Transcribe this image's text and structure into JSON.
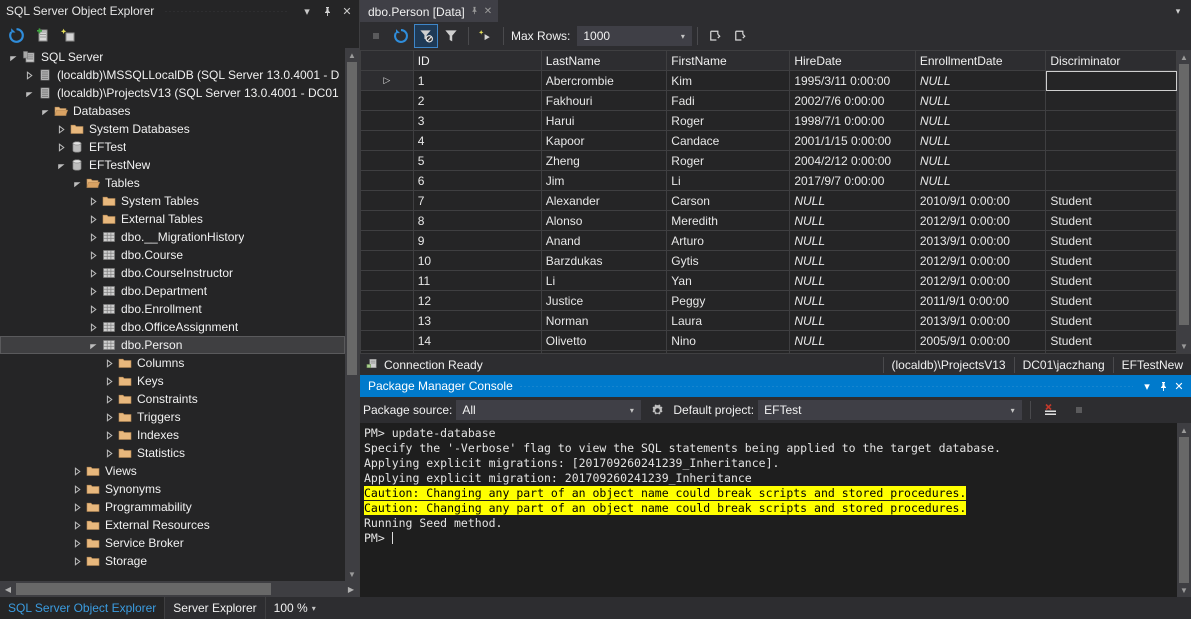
{
  "explorer": {
    "title": "SQL Server Object Explorer",
    "window_buttons": {
      "dropdown": "▾",
      "pin": "⚲",
      "close": "✕"
    },
    "toolbar": [
      {
        "name": "refresh-icon",
        "title": "Refresh"
      },
      {
        "name": "add-sql-server-icon",
        "title": "Add SQL Server"
      },
      {
        "name": "new-query-icon",
        "title": "New Query"
      }
    ],
    "tree": [
      {
        "label": "SQL Server",
        "depth": 0,
        "icon": "server-group-icon",
        "state": "expanded",
        "selected": false
      },
      {
        "label": "(localdb)\\MSSQLLocalDB (SQL Server 13.0.4001 - D",
        "depth": 1,
        "icon": "server-icon",
        "state": "collapsed",
        "selected": false
      },
      {
        "label": "(localdb)\\ProjectsV13 (SQL Server 13.0.4001 - DC01",
        "depth": 1,
        "icon": "server-icon",
        "state": "expanded",
        "selected": false
      },
      {
        "label": "Databases",
        "depth": 2,
        "icon": "folder-open-icon",
        "state": "expanded",
        "selected": false
      },
      {
        "label": "System Databases",
        "depth": 3,
        "icon": "folder-icon",
        "state": "collapsed",
        "selected": false
      },
      {
        "label": "EFTest",
        "depth": 3,
        "icon": "database-icon",
        "state": "collapsed",
        "selected": false
      },
      {
        "label": "EFTestNew",
        "depth": 3,
        "icon": "database-icon",
        "state": "expanded",
        "selected": false
      },
      {
        "label": "Tables",
        "depth": 4,
        "icon": "folder-open-icon",
        "state": "expanded",
        "selected": false
      },
      {
        "label": "System Tables",
        "depth": 5,
        "icon": "folder-icon",
        "state": "collapsed",
        "selected": false
      },
      {
        "label": "External Tables",
        "depth": 5,
        "icon": "folder-icon",
        "state": "collapsed",
        "selected": false
      },
      {
        "label": "dbo.__MigrationHistory",
        "depth": 5,
        "icon": "table-icon",
        "state": "collapsed",
        "selected": false
      },
      {
        "label": "dbo.Course",
        "depth": 5,
        "icon": "table-icon",
        "state": "collapsed",
        "selected": false
      },
      {
        "label": "dbo.CourseInstructor",
        "depth": 5,
        "icon": "table-icon",
        "state": "collapsed",
        "selected": false
      },
      {
        "label": "dbo.Department",
        "depth": 5,
        "icon": "table-icon",
        "state": "collapsed",
        "selected": false
      },
      {
        "label": "dbo.Enrollment",
        "depth": 5,
        "icon": "table-icon",
        "state": "collapsed",
        "selected": false
      },
      {
        "label": "dbo.OfficeAssignment",
        "depth": 5,
        "icon": "table-icon",
        "state": "collapsed",
        "selected": false
      },
      {
        "label": "dbo.Person",
        "depth": 5,
        "icon": "table-icon",
        "state": "expanded",
        "selected": true
      },
      {
        "label": "Columns",
        "depth": 6,
        "icon": "folder-icon",
        "state": "collapsed",
        "selected": false
      },
      {
        "label": "Keys",
        "depth": 6,
        "icon": "folder-icon",
        "state": "collapsed",
        "selected": false
      },
      {
        "label": "Constraints",
        "depth": 6,
        "icon": "folder-icon",
        "state": "collapsed",
        "selected": false
      },
      {
        "label": "Triggers",
        "depth": 6,
        "icon": "folder-icon",
        "state": "collapsed",
        "selected": false
      },
      {
        "label": "Indexes",
        "depth": 6,
        "icon": "folder-icon",
        "state": "collapsed",
        "selected": false
      },
      {
        "label": "Statistics",
        "depth": 6,
        "icon": "folder-icon",
        "state": "collapsed",
        "selected": false
      },
      {
        "label": "Views",
        "depth": 4,
        "icon": "folder-icon",
        "state": "collapsed",
        "selected": false
      },
      {
        "label": "Synonyms",
        "depth": 4,
        "icon": "folder-icon",
        "state": "collapsed",
        "selected": false
      },
      {
        "label": "Programmability",
        "depth": 4,
        "icon": "folder-icon",
        "state": "collapsed",
        "selected": false
      },
      {
        "label": "External Resources",
        "depth": 4,
        "icon": "folder-icon",
        "state": "collapsed",
        "selected": false
      },
      {
        "label": "Service Broker",
        "depth": 4,
        "icon": "folder-icon",
        "state": "collapsed",
        "selected": false
      },
      {
        "label": "Storage",
        "depth": 4,
        "icon": "folder-icon",
        "state": "collapsed",
        "selected": false
      }
    ]
  },
  "editor": {
    "tab": {
      "label": "dbo.Person [Data]",
      "pin": "⚲",
      "close": "✕"
    },
    "tabrow_menu": "▾",
    "toolbar": {
      "stop": {
        "name": "stop-icon",
        "enabled": false
      },
      "refresh": {
        "name": "refresh-icon"
      },
      "remove_filter": {
        "name": "remove-filter-icon",
        "active": true
      },
      "sort_filter": {
        "name": "sort-filter-icon"
      },
      "script": {
        "name": "script-icon"
      },
      "max_rows_label": "Max Rows:",
      "max_rows_value": "1000",
      "max_rows_arrow": "▾",
      "script_to_editor": {
        "name": "script-to-editor-icon"
      },
      "script_to_file": {
        "name": "script-to-file-icon"
      }
    },
    "grid": {
      "columns": [
        "ID",
        "LastName",
        "FirstName",
        "HireDate",
        "EnrollmentDate",
        "Discriminator"
      ],
      "rows": [
        {
          "indicator": "▷",
          "ID": "1",
          "LastName": "Abercrombie",
          "FirstName": "Kim",
          "HireDate": "1995/3/11 0:00:00",
          "EnrollmentDate": "NULL",
          "Discriminator": ""
        },
        {
          "indicator": "",
          "ID": "2",
          "LastName": "Fakhouri",
          "FirstName": "Fadi",
          "HireDate": "2002/7/6 0:00:00",
          "EnrollmentDate": "NULL",
          "Discriminator": ""
        },
        {
          "indicator": "",
          "ID": "3",
          "LastName": "Harui",
          "FirstName": "Roger",
          "HireDate": "1998/7/1 0:00:00",
          "EnrollmentDate": "NULL",
          "Discriminator": ""
        },
        {
          "indicator": "",
          "ID": "4",
          "LastName": "Kapoor",
          "FirstName": "Candace",
          "HireDate": "2001/1/15 0:00:00",
          "EnrollmentDate": "NULL",
          "Discriminator": ""
        },
        {
          "indicator": "",
          "ID": "5",
          "LastName": "Zheng",
          "FirstName": "Roger",
          "HireDate": "2004/2/12 0:00:00",
          "EnrollmentDate": "NULL",
          "Discriminator": ""
        },
        {
          "indicator": "",
          "ID": "6",
          "LastName": "Jim",
          "FirstName": "Li",
          "HireDate": "2017/9/7 0:00:00",
          "EnrollmentDate": "NULL",
          "Discriminator": ""
        },
        {
          "indicator": "",
          "ID": "7",
          "LastName": "Alexander",
          "FirstName": "Carson",
          "HireDate": "NULL",
          "EnrollmentDate": "2010/9/1 0:00:00",
          "Discriminator": "Student"
        },
        {
          "indicator": "",
          "ID": "8",
          "LastName": "Alonso",
          "FirstName": "Meredith",
          "HireDate": "NULL",
          "EnrollmentDate": "2012/9/1 0:00:00",
          "Discriminator": "Student"
        },
        {
          "indicator": "",
          "ID": "9",
          "LastName": "Anand",
          "FirstName": "Arturo",
          "HireDate": "NULL",
          "EnrollmentDate": "2013/9/1 0:00:00",
          "Discriminator": "Student"
        },
        {
          "indicator": "",
          "ID": "10",
          "LastName": "Barzdukas",
          "FirstName": "Gytis",
          "HireDate": "NULL",
          "EnrollmentDate": "2012/9/1 0:00:00",
          "Discriminator": "Student"
        },
        {
          "indicator": "",
          "ID": "11",
          "LastName": "Li",
          "FirstName": "Yan",
          "HireDate": "NULL",
          "EnrollmentDate": "2012/9/1 0:00:00",
          "Discriminator": "Student"
        },
        {
          "indicator": "",
          "ID": "12",
          "LastName": "Justice",
          "FirstName": "Peggy",
          "HireDate": "NULL",
          "EnrollmentDate": "2011/9/1 0:00:00",
          "Discriminator": "Student"
        },
        {
          "indicator": "",
          "ID": "13",
          "LastName": "Norman",
          "FirstName": "Laura",
          "HireDate": "NULL",
          "EnrollmentDate": "2013/9/1 0:00:00",
          "Discriminator": "Student"
        },
        {
          "indicator": "",
          "ID": "14",
          "LastName": "Olivetto",
          "FirstName": "Nino",
          "HireDate": "NULL",
          "EnrollmentDate": "2005/9/1 0:00:00",
          "Discriminator": "Student"
        }
      ]
    },
    "status": {
      "connection": "Connection Ready",
      "server": "(localdb)\\ProjectsV13",
      "user": "DC01\\jaczhang",
      "database": "EFTestNew"
    }
  },
  "console": {
    "title": "Package Manager Console",
    "window_buttons": {
      "dropdown": "▾",
      "pin": "⚲",
      "close": "✕"
    },
    "toolbar": {
      "package_source_label": "Package source:",
      "package_source_value": "All",
      "settings_icon": "gear-icon",
      "default_project_label": "Default project:",
      "default_project_value": "EFTest",
      "clear_icon": "clear-console-icon",
      "stop_icon": "stop-icon",
      "combo_arrow": "▾"
    },
    "lines": [
      {
        "text": "PM> update-database",
        "highlight": false
      },
      {
        "text": "Specify the '-Verbose' flag to view the SQL statements being applied to the target database.",
        "highlight": false
      },
      {
        "text": "Applying explicit migrations: [201709260241239_Inheritance].",
        "highlight": false
      },
      {
        "text": "Applying explicit migration: 201709260241239_Inheritance",
        "highlight": false
      },
      {
        "text": "Caution: Changing any part of an object name could break scripts and stored procedures.",
        "highlight": true
      },
      {
        "text": "Caution: Changing any part of an object name could break scripts and stored procedures.",
        "highlight": true
      },
      {
        "text": "Running Seed method.",
        "highlight": false
      }
    ],
    "prompt": "PM> "
  },
  "statusbar": {
    "tabs": [
      {
        "label": "SQL Server Object Explorer",
        "active": true
      },
      {
        "label": "Server Explorer",
        "active": false
      }
    ],
    "zoom": "100 %",
    "zoom_arrow": "▾"
  },
  "colors": {
    "accent": "#007acc",
    "highlight": "#ffff00",
    "folder": "#e8b87d",
    "link": "#3b9ce0"
  }
}
